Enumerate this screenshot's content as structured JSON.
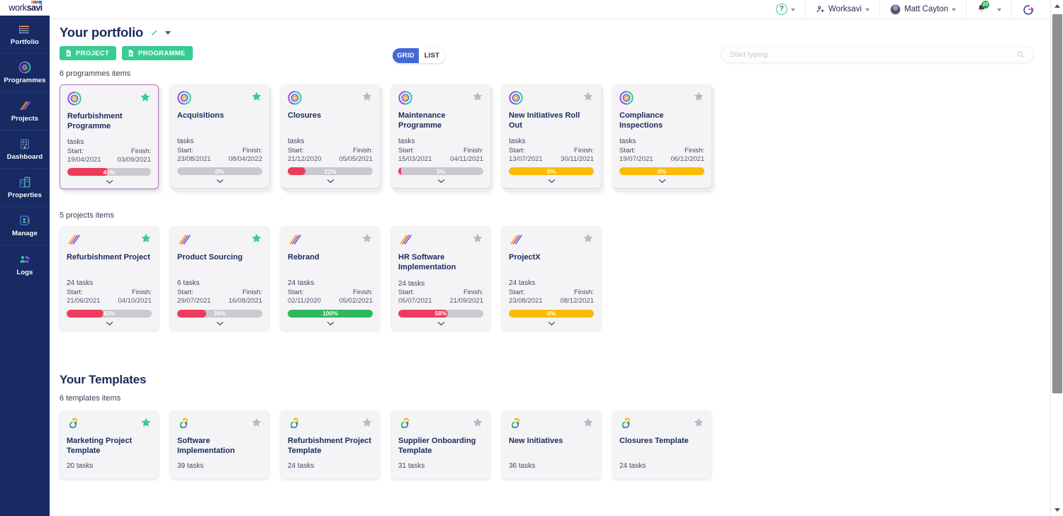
{
  "brand": {
    "logo_work": "work",
    "logo_savi": "savi"
  },
  "sidebar": {
    "items": [
      {
        "label": "Portfolio",
        "icon": "lines-icon"
      },
      {
        "label": "Programmes",
        "icon": "target-icon"
      },
      {
        "label": "Projects",
        "icon": "stripes-icon"
      },
      {
        "label": "Dashboard",
        "icon": "building-icon"
      },
      {
        "label": "Properties",
        "icon": "buildings-icon"
      },
      {
        "label": "Manage",
        "icon": "contact-card-icon"
      },
      {
        "label": "Logs",
        "icon": "people-icon"
      }
    ]
  },
  "topbar": {
    "help_glyph": "?",
    "org_label": "Worksavi",
    "user_label": "Matt Cayton",
    "notification_count": "20",
    "icons": {
      "help": "help-circle-icon",
      "org": "org-switch-icon",
      "avatar": "user-avatar",
      "bell": "bell-icon",
      "logout": "logout-icon"
    }
  },
  "page": {
    "title": "Your portfolio",
    "edit_icon": "pencil-icon",
    "title_menu_icon": "chevron-down-icon",
    "buttons": [
      {
        "label": "PROJECT",
        "icon": "add-file-icon"
      },
      {
        "label": "PROGRAMME",
        "icon": "add-file-icon"
      }
    ],
    "view_toggle": {
      "options": [
        "GRID",
        "LIST"
      ],
      "selected": "GRID"
    },
    "search": {
      "value": "",
      "placeholder": "Start typing",
      "icon": "search-icon"
    }
  },
  "programmes": {
    "count_label": "6 programmes items",
    "items": [
      {
        "name": "Refurbishment Programme",
        "tasks": "tasks",
        "start_label": "Start:",
        "finish_label": "Finish:",
        "start": "19/04/2021",
        "finish": "03/09/2021",
        "progress": 49,
        "progress_label": "49%",
        "color": "#ef3b5b",
        "starred": true,
        "selected": true
      },
      {
        "name": "Acquisitions",
        "tasks": "tasks",
        "start_label": "Start:",
        "finish_label": "Finish:",
        "start": "23/08/2021",
        "finish": "08/04/2022",
        "progress": 0,
        "progress_label": "0%",
        "color": "#c9c9cf",
        "starred": true,
        "selected": false
      },
      {
        "name": "Closures",
        "tasks": "tasks",
        "start_label": "Start:",
        "finish_label": "Finish:",
        "start": "21/12/2020",
        "finish": "05/05/2021",
        "progress": 21,
        "progress_label": "21%",
        "color": "#ef3b5b",
        "starred": false,
        "selected": false
      },
      {
        "name": "Maintenance Programme",
        "tasks": "tasks",
        "start_label": "Start:",
        "finish_label": "Finish:",
        "start": "15/03/2021",
        "finish": "04/11/2021",
        "progress": 3,
        "progress_label": "3%",
        "color": "#ef3b5b",
        "starred": false,
        "selected": false
      },
      {
        "name": "New Initiatives Roll Out",
        "tasks": "tasks",
        "start_label": "Start:",
        "finish_label": "Finish:",
        "start": "13/07/2021",
        "finish": "30/11/2021",
        "progress": 100,
        "progress_label": "0%",
        "color": "#fbbc05",
        "starred": false,
        "selected": false
      },
      {
        "name": "Compliance Inspections",
        "tasks": "tasks",
        "start_label": "Start:",
        "finish_label": "Finish:",
        "start": "19/07/2021",
        "finish": "06/12/2021",
        "progress": 100,
        "progress_label": "0%",
        "color": "#fbbc05",
        "starred": false,
        "selected": false
      }
    ]
  },
  "projects": {
    "count_label": "5 projects items",
    "items": [
      {
        "name": "Refurbishment Project",
        "tasks": "24 tasks",
        "start_label": "Start:",
        "finish_label": "Finish:",
        "start": "21/06/2021",
        "finish": "04/10/2021",
        "progress": 43,
        "progress_label": "43%",
        "color": "#ef3b5b",
        "starred": true
      },
      {
        "name": "Product Sourcing",
        "tasks": "6 tasks",
        "start_label": "Start:",
        "finish_label": "Finish:",
        "start": "29/07/2021",
        "finish": "16/08/2021",
        "progress": 34,
        "progress_label": "34%",
        "color": "#ef3b5b",
        "starred": true
      },
      {
        "name": "Rebrand",
        "tasks": "24 tasks",
        "start_label": "Start:",
        "finish_label": "Finish:",
        "start": "02/11/2020",
        "finish": "05/02/2021",
        "progress": 100,
        "progress_label": "100%",
        "color": "#2eb85c",
        "starred": false
      },
      {
        "name": "HR Software Implementation",
        "tasks": "24 tasks",
        "start_label": "Start:",
        "finish_label": "Finish:",
        "start": "05/07/2021",
        "finish": "21/09/2021",
        "progress": 58,
        "progress_label": "58%",
        "color": "#ef3b5b",
        "starred": false
      },
      {
        "name": "ProjectX",
        "tasks": "24 tasks",
        "start_label": "Start:",
        "finish_label": "Finish:",
        "start": "23/08/2021",
        "finish": "08/12/2021",
        "progress": 100,
        "progress_label": "0%",
        "color": "#fbbc05",
        "starred": false
      }
    ]
  },
  "templates": {
    "section_title": "Your Templates",
    "count_label": "6 templates items",
    "items": [
      {
        "name": "Marketing Project Template",
        "tasks": "20 tasks",
        "starred": true
      },
      {
        "name": "Software Implementation",
        "tasks": "39 tasks",
        "starred": false
      },
      {
        "name": "Refurbishment Project Template",
        "tasks": "24 tasks",
        "starred": false
      },
      {
        "name": "Supplier Onboarding Template",
        "tasks": "31 tasks",
        "starred": false
      },
      {
        "name": "New Initiatives",
        "tasks": "36 tasks",
        "starred": false
      },
      {
        "name": "Closures Template",
        "tasks": "24 tasks",
        "starred": false
      }
    ]
  },
  "colors": {
    "sidebar": "#172a62",
    "accent_green": "#37cc92",
    "accent_blue": "#4169d8",
    "red": "#ef3b5b",
    "amber": "#fbbc05",
    "green": "#2eb85c",
    "selected_border": "#b07cc0"
  }
}
